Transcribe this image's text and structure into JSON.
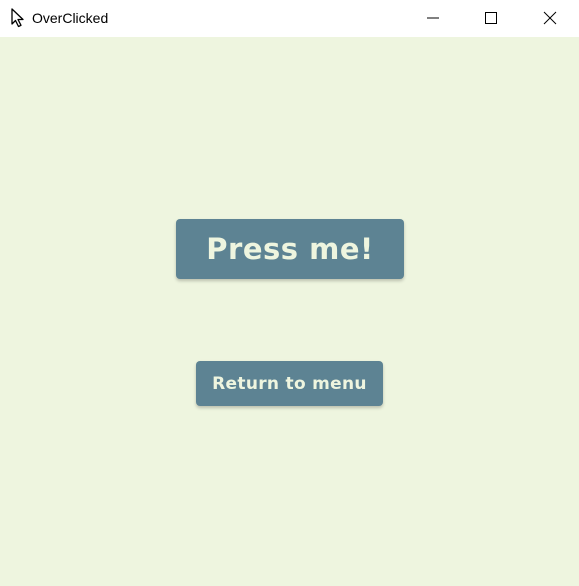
{
  "window": {
    "title": "OverClicked",
    "icon": "cursor-arrow-icon",
    "controls": [
      "minimize-icon",
      "maximize-icon",
      "close-icon"
    ]
  },
  "main": {
    "press_button_label": "Press me!",
    "return_button_label": "Return to menu"
  },
  "colors": {
    "background": "#eef5df",
    "button": "#5d8393",
    "button_text": "#eef5df"
  }
}
